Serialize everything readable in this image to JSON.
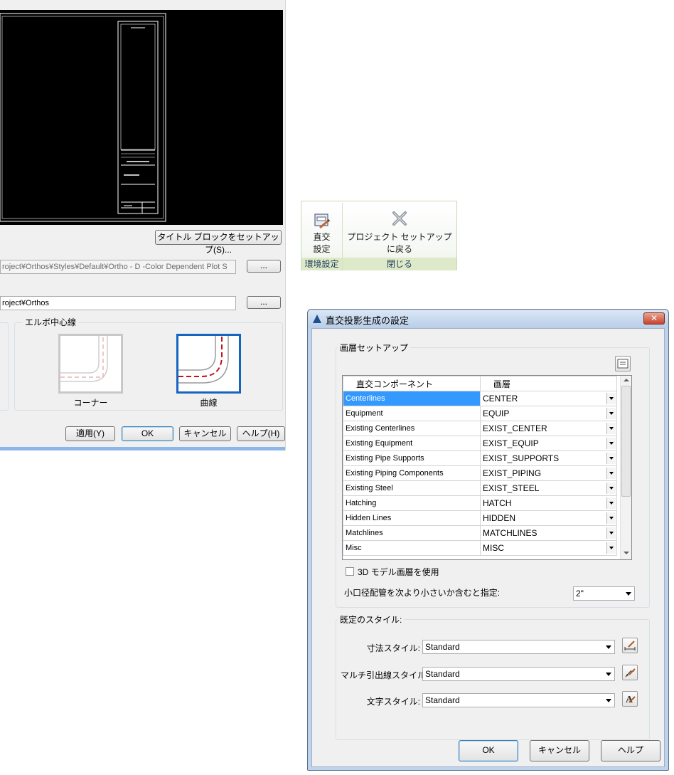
{
  "left_dialog": {
    "title_block_button": "タイトル ブロックをセットアップ(S)...",
    "style_path": "roject¥Orthos¥Styles¥Default¥Ortho - D -Color Dependent Plot S",
    "browse_label": "...",
    "output_path": "roject¥Orthos",
    "elbow_group_label": "エルボ中心線",
    "corner_label": "コーナー",
    "curve_label": "曲線",
    "apply_button": "適用(Y)",
    "ok_button": "OK",
    "cancel_button": "キャンセル",
    "help_button": "ヘルプ(H)"
  },
  "ribbon": {
    "ortho_button_line1": "直交",
    "ortho_button_line2": "設定",
    "return_button_line1": "プロジェクト セットアップ",
    "return_button_line2": "に戻る",
    "panel_settings": "環境設定",
    "panel_close": "閉じる"
  },
  "dialog": {
    "title": "直交投影生成の設定",
    "layer_setup_group": "画層セットアップ",
    "grid": {
      "columns": [
        "直交コンポーネント",
        "画層"
      ],
      "rows": [
        {
          "component": "Centerlines",
          "layer": "CENTER",
          "selected": true
        },
        {
          "component": "Equipment",
          "layer": "EQUIP"
        },
        {
          "component": "Existing Centerlines",
          "layer": "EXIST_CENTER"
        },
        {
          "component": "Existing Equipment",
          "layer": "EXIST_EQUIP"
        },
        {
          "component": "Existing Pipe Supports",
          "layer": "EXIST_SUPPORTS"
        },
        {
          "component": "Existing Piping Components",
          "layer": "EXIST_PIPING"
        },
        {
          "component": "Existing Steel",
          "layer": "EXIST_STEEL"
        },
        {
          "component": "Hatching",
          "layer": "HATCH"
        },
        {
          "component": "Hidden Lines",
          "layer": "HIDDEN"
        },
        {
          "component": "Matchlines",
          "layer": "MATCHLINES"
        },
        {
          "component": "Misc",
          "layer": "MISC"
        }
      ]
    },
    "use_3d_layers_label": "3D モデル画層を使用",
    "small_pipe_label": "小口径配管を次より小さいか含むと指定:",
    "small_pipe_value": "2\"",
    "styles_group": "既定のスタイル:",
    "dim_style_label": "寸法スタイル:",
    "dim_style_value": "Standard",
    "mleader_style_label": "マルチ引出線スタイル:",
    "mleader_style_value": "Standard",
    "text_style_label": "文字スタイル:",
    "text_style_value": "Standard",
    "ok_button": "OK",
    "cancel_button": "キャンセル",
    "help_button": "ヘルプ",
    "close_glyph": "✕"
  }
}
